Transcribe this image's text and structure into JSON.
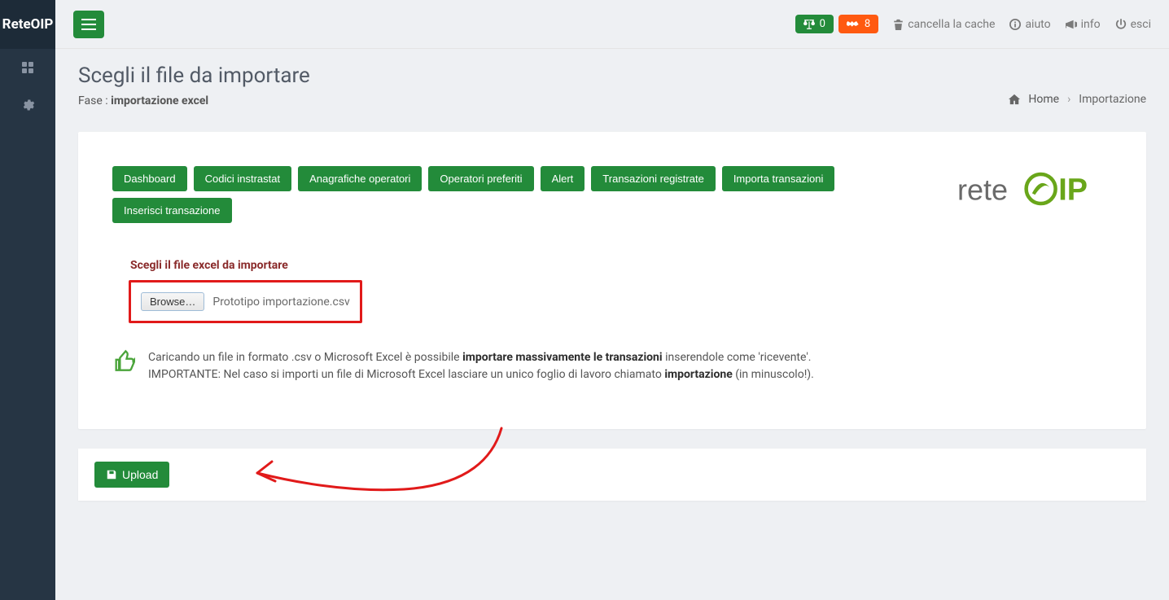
{
  "brand": "ReteOIP",
  "header": {
    "balance_badge": "0",
    "handshake_badge": "8",
    "cancel_cache": "cancella la cache",
    "help": "aiuto",
    "info": "info",
    "logout": "esci"
  },
  "page": {
    "title": "Scegli il file da importare",
    "phase_prefix": "Fase : ",
    "phase_value": "importazione excel"
  },
  "breadcrumb": {
    "home": "Home",
    "current": "Importazione"
  },
  "tabs": [
    "Dashboard",
    "Codici instrastat",
    "Anagrafiche operatori",
    "Operatori preferiti",
    "Alert",
    "Transazioni registrate",
    "Importa transazioni",
    "Inserisci transazione"
  ],
  "form": {
    "field_label": "Scegli il file excel da importare",
    "browse_label": "Browse…",
    "file_name": "Prototipo importazione.csv"
  },
  "hint": {
    "line1_a": "Caricando un file in formato .csv o Microsoft Excel è possibile ",
    "line1_b": "importare massivamente le transazioni",
    "line1_c": " inserendole come 'ricevente'.",
    "line2_a": "IMPORTANTE: Nel caso si importi un file di Microsoft Excel lasciare un unico foglio di lavoro chiamato ",
    "line2_b": "importazione",
    "line2_c": " (in minuscolo!)."
  },
  "upload_label": "Upload",
  "logo": {
    "text_left": "rete",
    "text_right": "IP"
  }
}
